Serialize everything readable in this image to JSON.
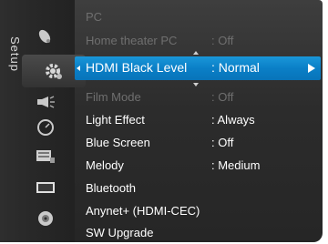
{
  "sidebar": {
    "title": "Setup"
  },
  "menu": {
    "items": [
      {
        "label": "PC",
        "value": "",
        "state": "dim"
      },
      {
        "label": "Home theater PC",
        "value": ": Off",
        "state": "dim"
      },
      {
        "label": "HDMI Black Level",
        "value": ": Normal",
        "state": "selected"
      },
      {
        "label": "Film Mode",
        "value": ": Off",
        "state": "dim"
      },
      {
        "label": "Light Effect",
        "value": ": Always",
        "state": "normal"
      },
      {
        "label": "Blue Screen",
        "value": ": Off",
        "state": "normal"
      },
      {
        "label": "Melody",
        "value": ": Medium",
        "state": "normal"
      },
      {
        "label": "Bluetooth",
        "value": "",
        "state": "normal"
      },
      {
        "label": "Anynet+ (HDMI-CEC)",
        "value": "",
        "state": "normal"
      },
      {
        "label": "SW Upgrade",
        "value": "",
        "state": "normal"
      }
    ]
  },
  "colors": {
    "highlight": "#0a7fc7",
    "dim_text": "#6f6f6f",
    "text": "#ffffff"
  },
  "icons": [
    "satellite-dish-icon",
    "gear-icon",
    "speaker-icon",
    "clock-icon",
    "channel-list-icon",
    "screen-icon",
    "disc-icon"
  ]
}
